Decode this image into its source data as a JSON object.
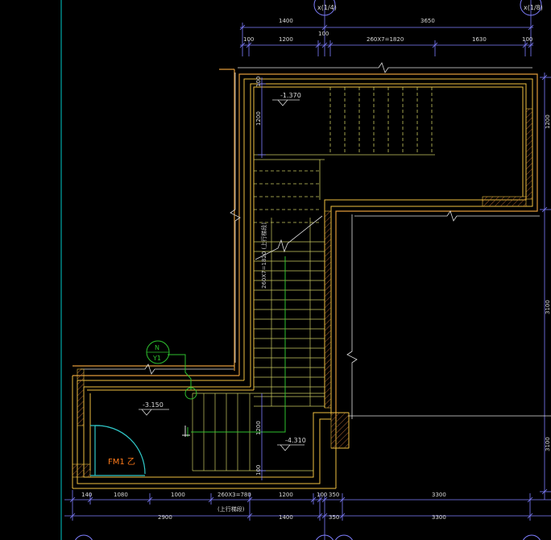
{
  "colors": {
    "background": "#000000",
    "wall": "#f0c040",
    "wall_outer": "#e09a3a",
    "stair": "#c8c860",
    "dimension": "#7f7fff",
    "text": "#d8d8d8",
    "accent_green": "#2ec02e",
    "door": "#30c8c8",
    "door_label": "#ff7a1a",
    "hatch": "#a86030",
    "border": "#00c8c8"
  },
  "top_dims": {
    "row1": [
      "1400",
      "3650"
    ],
    "row2": [
      "100",
      "1200",
      "100",
      "260X7=1820",
      "1630",
      "100"
    ]
  },
  "top_axes": [
    "x(1/4)",
    "x(1/8)"
  ],
  "right_dims": [
    "1200",
    "3100",
    "3100"
  ],
  "left_vertical_dims": [
    "1200",
    "1200",
    "100"
  ],
  "bottom_dims": {
    "row1": [
      "140",
      "1080",
      "1000",
      "260X3=780",
      "1200",
      "100",
      "350",
      "3300"
    ],
    "row2": [
      "2900",
      "1400",
      "350",
      "3300"
    ]
  },
  "labels": {
    "level_top": "-1.370",
    "level_mid": "-3.150",
    "level_bottom": "-4.310",
    "stair_run_note": "260X7=1820 (上行梯段)",
    "bottom_stair_note": "(上行梯段)",
    "door_code": "FM1 乙",
    "north_mark": "N",
    "north_sub": "Y1"
  },
  "icons": [
    "north-arrow-icon",
    "level-triangle-icon",
    "axis-bubble-icon",
    "break-line-icon"
  ]
}
